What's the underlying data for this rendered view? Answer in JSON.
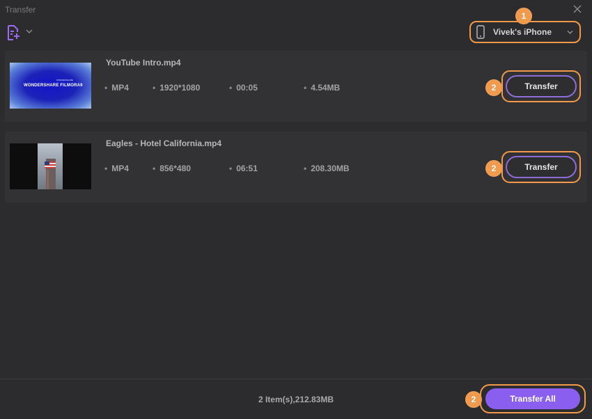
{
  "window": {
    "title": "Transfer"
  },
  "toolbar": {
    "add_icon": "add-file-icon",
    "device_name": "Vivek's iPhone"
  },
  "badges": {
    "device": "1",
    "transfer": "2"
  },
  "files": [
    {
      "name": "YouTube Intro.mp4",
      "format": "MP4",
      "resolution": "1920*1080",
      "duration": "00:05",
      "size": "4.54MB",
      "thumb_text": "WONDERSHARE FILMORA9",
      "thumb_small": "WONDERSHARE",
      "button": "Transfer"
    },
    {
      "name": "Eagles - Hotel California.mp4",
      "format": "MP4",
      "resolution": "856*480",
      "duration": "06:51",
      "size": "208.30MB",
      "button": "Transfer"
    }
  ],
  "footer": {
    "summary": "2 Item(s),212.83MB",
    "transfer_all": "Transfer All"
  },
  "colors": {
    "accent": "#8a5ff0",
    "highlight": "#f29a4a",
    "background": "#2c2c2e"
  }
}
